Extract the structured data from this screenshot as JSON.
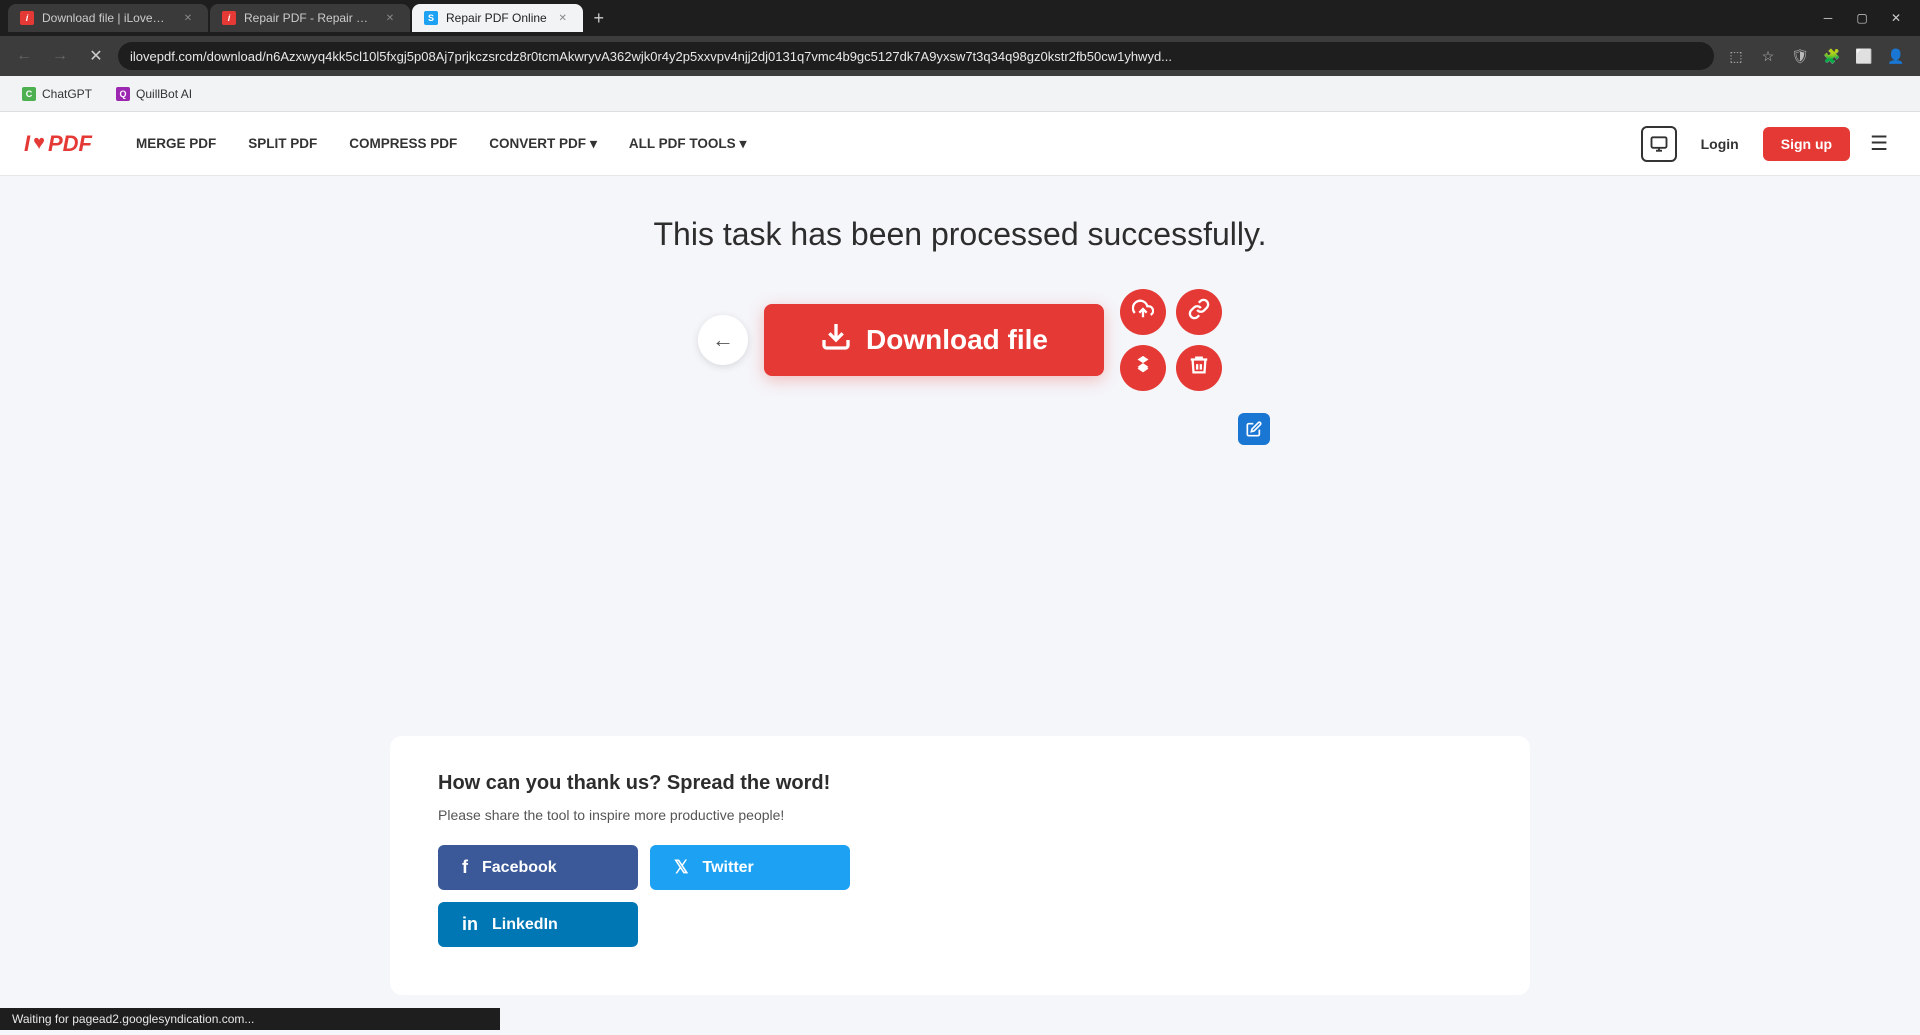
{
  "browser": {
    "tabs": [
      {
        "id": "tab1",
        "label": "Download file | iLovePDF",
        "active": false,
        "favicon_color": "#e53935",
        "favicon_text": "i"
      },
      {
        "id": "tab2",
        "label": "Repair PDF - Repair PDF online",
        "active": false,
        "favicon_color": "#e53935",
        "favicon_text": "i"
      },
      {
        "id": "tab3",
        "label": "Repair PDF Online",
        "active": true,
        "favicon_color": "#1da1f2",
        "favicon_text": "S"
      }
    ],
    "url": "ilovepdf.com/download/n6Azxwyq4kk5cl10l5fxgj5p08Aj7prjkczsrcdz8r0tcmAkwryvA362wjk0r4y2p5xxvpv4njj2dj0131q7vmc4b9gc5127dk7A9yxsw7t3q34q98gz0kstr2fb50cw1yhwyd...",
    "bookmarks": [
      {
        "id": "bm1",
        "label": "ChatGPT",
        "favicon_color": "#4CAF50",
        "favicon_text": "C"
      },
      {
        "id": "bm2",
        "label": "QuillBot AI",
        "favicon_color": "#9c27b0",
        "favicon_text": "Q"
      }
    ]
  },
  "nav": {
    "logo_text": "I ♥ PDF",
    "links": [
      {
        "id": "merge",
        "label": "MERGE PDF"
      },
      {
        "id": "split",
        "label": "SPLIT PDF"
      },
      {
        "id": "compress",
        "label": "COMPRESS PDF"
      },
      {
        "id": "convert",
        "label": "CONVERT PDF",
        "has_dropdown": true
      },
      {
        "id": "all_tools",
        "label": "ALL PDF TOOLS",
        "has_dropdown": true
      }
    ],
    "login_label": "Login",
    "signup_label": "Sign up"
  },
  "main": {
    "success_message": "This task has been processed successfully.",
    "download_button_label": "Download file",
    "action_icons": [
      {
        "id": "upload",
        "title": "Upload to cloud"
      },
      {
        "id": "link",
        "title": "Copy link"
      },
      {
        "id": "dropbox",
        "title": "Save to Dropbox"
      },
      {
        "id": "delete",
        "title": "Delete"
      }
    ]
  },
  "share": {
    "title": "How can you thank us? Spread the word!",
    "subtitle": "Please share the tool to inspire more productive people!",
    "buttons": [
      {
        "id": "facebook",
        "label": "Facebook",
        "network": "facebook"
      },
      {
        "id": "twitter",
        "label": "Twitter",
        "network": "twitter"
      },
      {
        "id": "linkedin",
        "label": "LinkedIn",
        "network": "linkedin"
      }
    ]
  },
  "status_bar": {
    "text": "Waiting for pagead2.googlesyndication.com..."
  }
}
